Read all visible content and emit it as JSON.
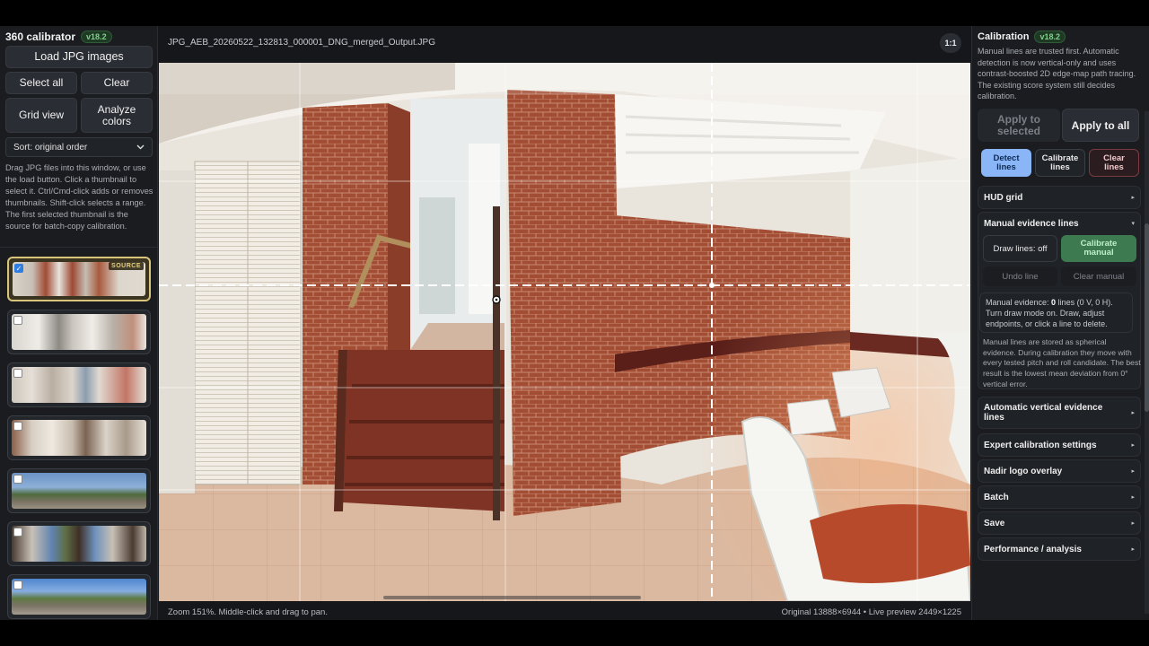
{
  "left": {
    "app_title": "360 calibrator",
    "version": "v18.2",
    "load_button": "Load JPG images",
    "select_all": "Select all",
    "clear": "Clear",
    "grid_view": "Grid view",
    "analyze_colors": "Analyze colors",
    "sort_value": "Sort: original order",
    "help_text": "Drag JPG files into this window, or use the load button. Click a thumbnail to select it. Ctrl/Cmd-click adds or removes thumbnails. Shift-click selects a range. The first selected thumbnail is the source for batch-copy calibration.",
    "source_tag": "SOURCE",
    "checkmark": "✓"
  },
  "center": {
    "filename": "JPG_AEB_20260522_132813_000001_DNG_merged_Output.JPG",
    "zoom_mode": "1:1",
    "status_left": "Zoom 151%. Middle-click and drag to pan.",
    "status_right": "Original 13888×6944 • Live preview 2449×1225"
  },
  "right": {
    "title": "Calibration",
    "version": "v18.2",
    "description": "Manual lines are trusted first. Automatic detection is now vertical-only and uses contrast-boosted 2D edge-map path tracing. The existing score system still decides calibration.",
    "apply_selected": "Apply to selected",
    "apply_all": "Apply to all",
    "detect_lines": "Detect lines",
    "calibrate_lines": "Calibrate lines",
    "clear_lines": "Clear lines",
    "hud_grid": "HUD grid",
    "manual_evidence": "Manual evidence lines",
    "draw_lines": "Draw lines: off",
    "calibrate_manual": "Calibrate manual",
    "undo_line": "Undo line",
    "clear_manual": "Clear manual",
    "evidence_prefix": "Manual evidence: ",
    "evidence_count": "0",
    "evidence_suffix": " lines (0 V, 0 H). Turn draw mode on. Draw, adjust endpoints, or click a line to delete.",
    "manual_note": "Manual lines are stored as spherical evidence. During calibration they move with every tested pitch and roll candidate. The best result is the lowest mean deviation from 0° vertical error.",
    "auto_vertical": "Automatic vertical evidence lines",
    "expert_settings": "Expert calibration settings",
    "nadir_logo": "Nadir logo overlay",
    "batch": "Batch",
    "save": "Save",
    "performance": "Performance / analysis",
    "arrow_right": "▸",
    "arrow_down": "▾"
  },
  "icons": {
    "chevron": "chevron-down-icon",
    "crosshair": "crosshair-icon"
  }
}
